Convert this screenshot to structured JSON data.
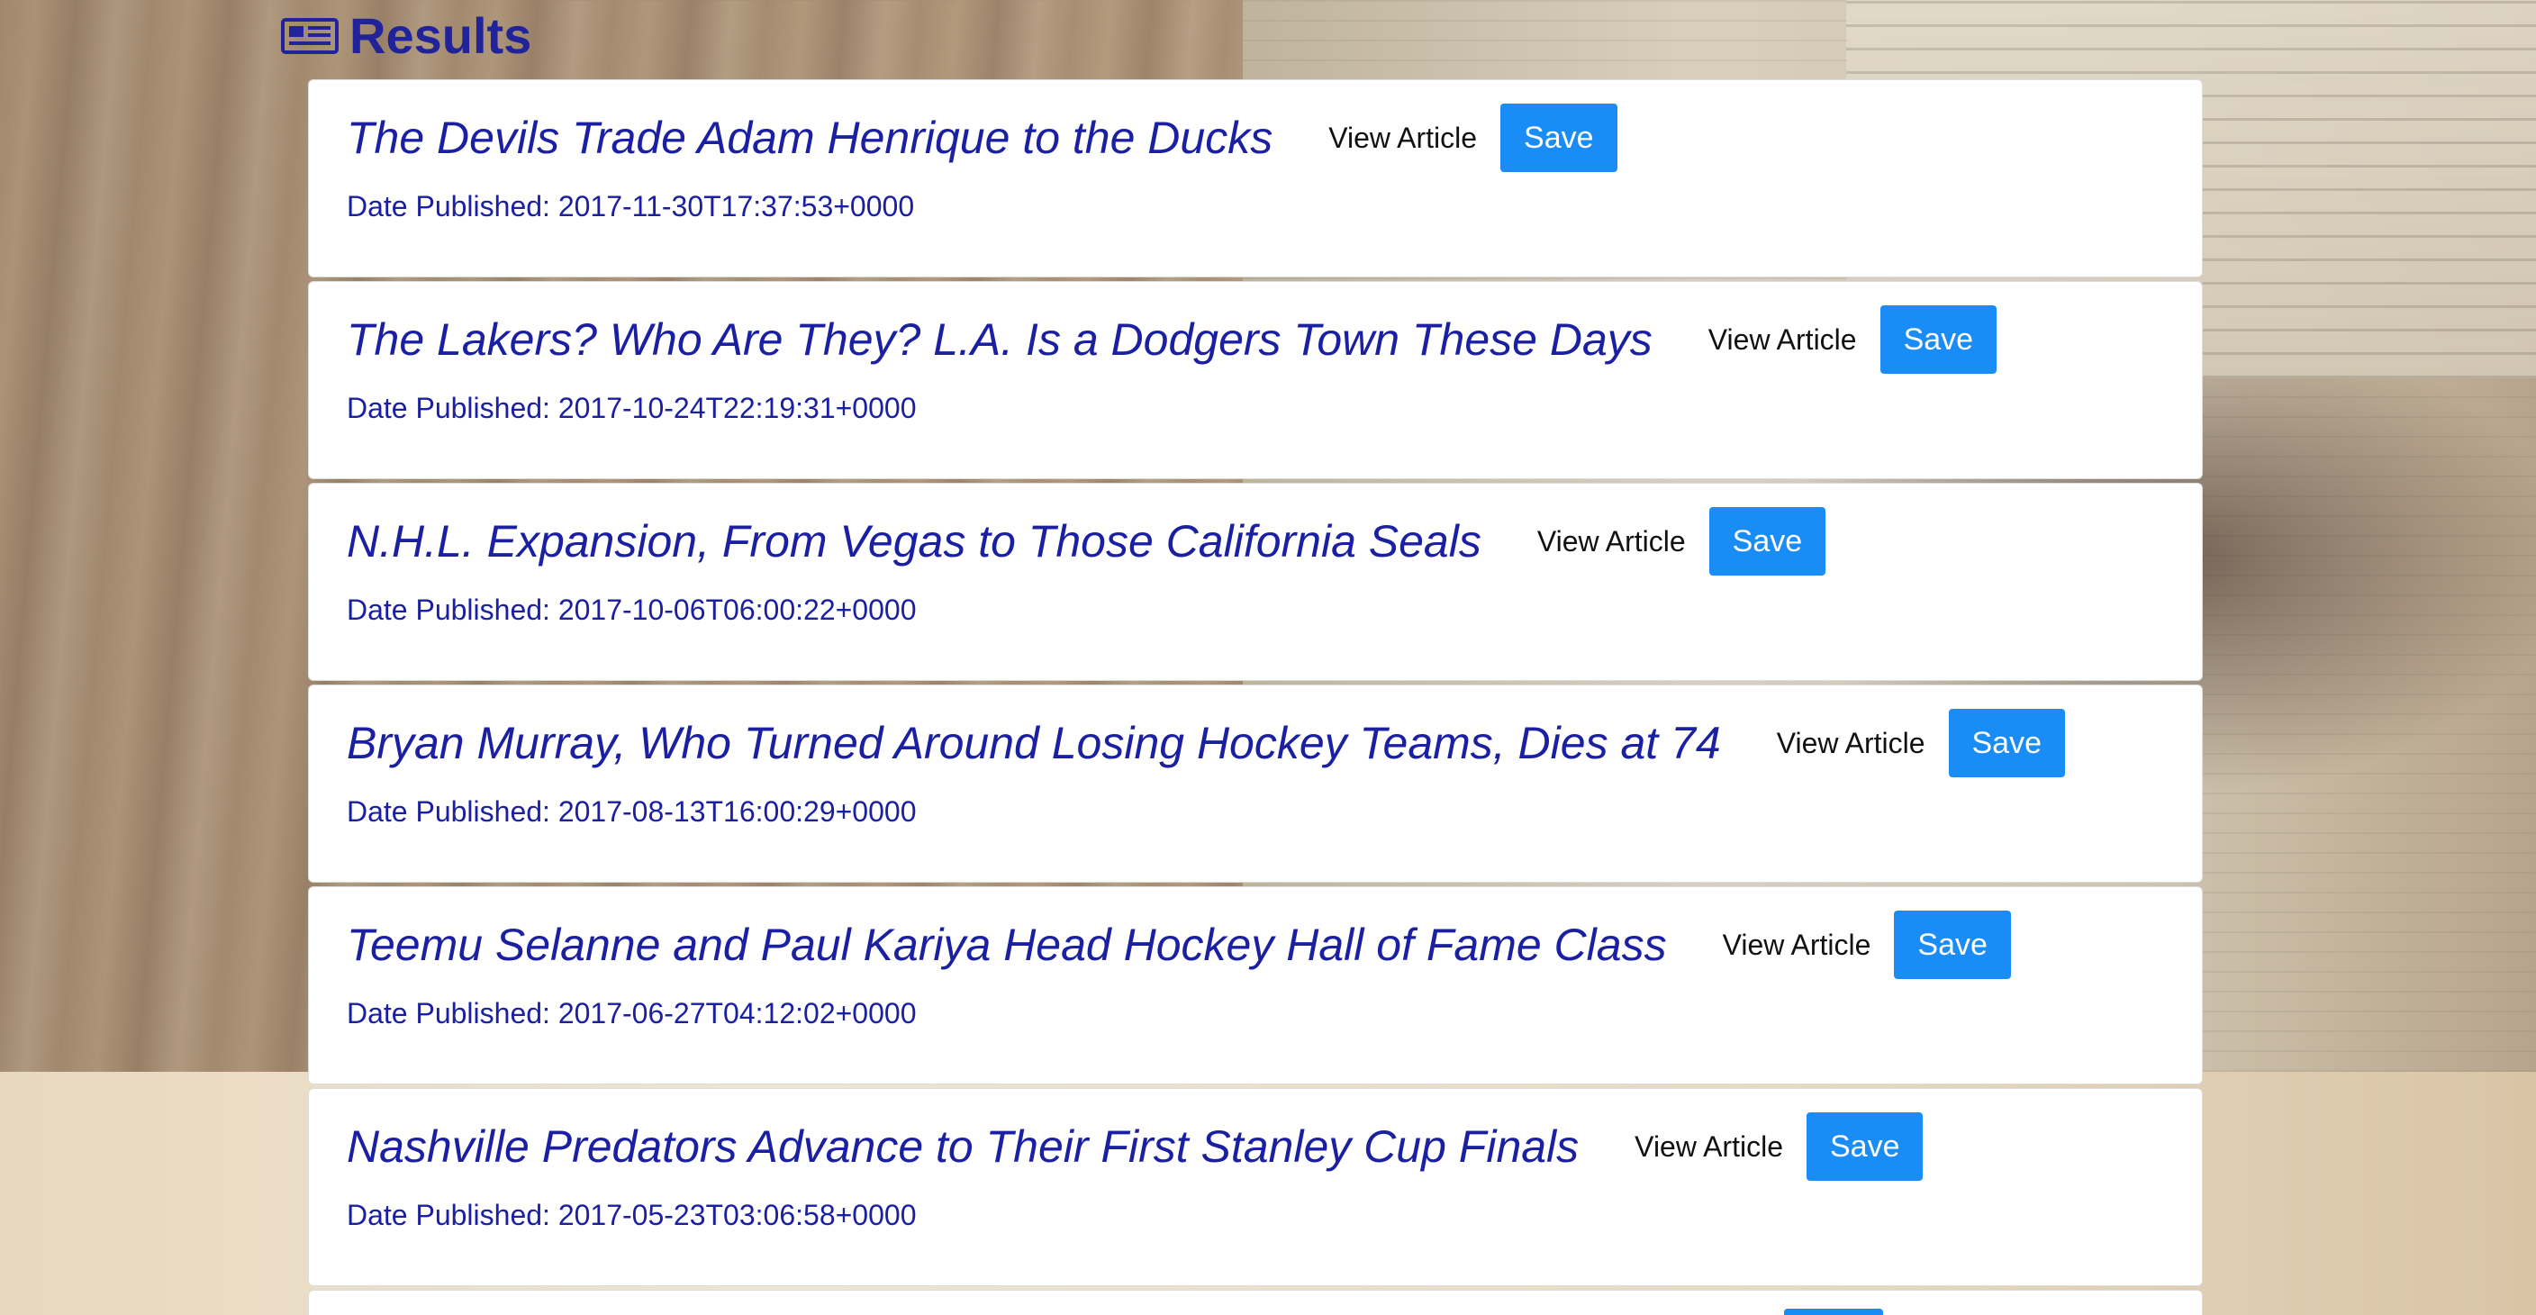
{
  "header": {
    "title": "Results",
    "icon": "newspaper-icon"
  },
  "colors": {
    "accent": "#1a8cf6",
    "title": "#1b20a3"
  },
  "articles": [
    {
      "title": "The Devils Trade Adam Henrique to the Ducks",
      "view_label": "View Article",
      "save_label": "Save",
      "date": "Date Published: 2017-11-30T17:37:53+0000"
    },
    {
      "title": "The Lakers? Who Are They? L.A. Is a Dodgers Town These Days",
      "view_label": "View Article",
      "save_label": "Save",
      "date": "Date Published: 2017-10-24T22:19:31+0000"
    },
    {
      "title": "N.H.L. Expansion, From Vegas to Those California Seals",
      "view_label": "View Article",
      "save_label": "Save",
      "date": "Date Published: 2017-10-06T06:00:22+0000"
    },
    {
      "title": "Bryan Murray, Who Turned Around Losing Hockey Teams, Dies at 74",
      "view_label": "View Article",
      "save_label": "Save",
      "date": "Date Published: 2017-08-13T16:00:29+0000"
    },
    {
      "title": "Teemu Selanne and Paul Kariya Head Hockey Hall of Fame Class",
      "view_label": "View Article",
      "save_label": "Save",
      "date": "Date Published: 2017-06-27T04:12:02+0000"
    },
    {
      "title": "Nashville Predators Advance to Their First Stanley Cup Finals",
      "view_label": "View Article",
      "save_label": "Save",
      "date": "Date Published: 2017-05-23T03:06:58+0000"
    }
  ]
}
